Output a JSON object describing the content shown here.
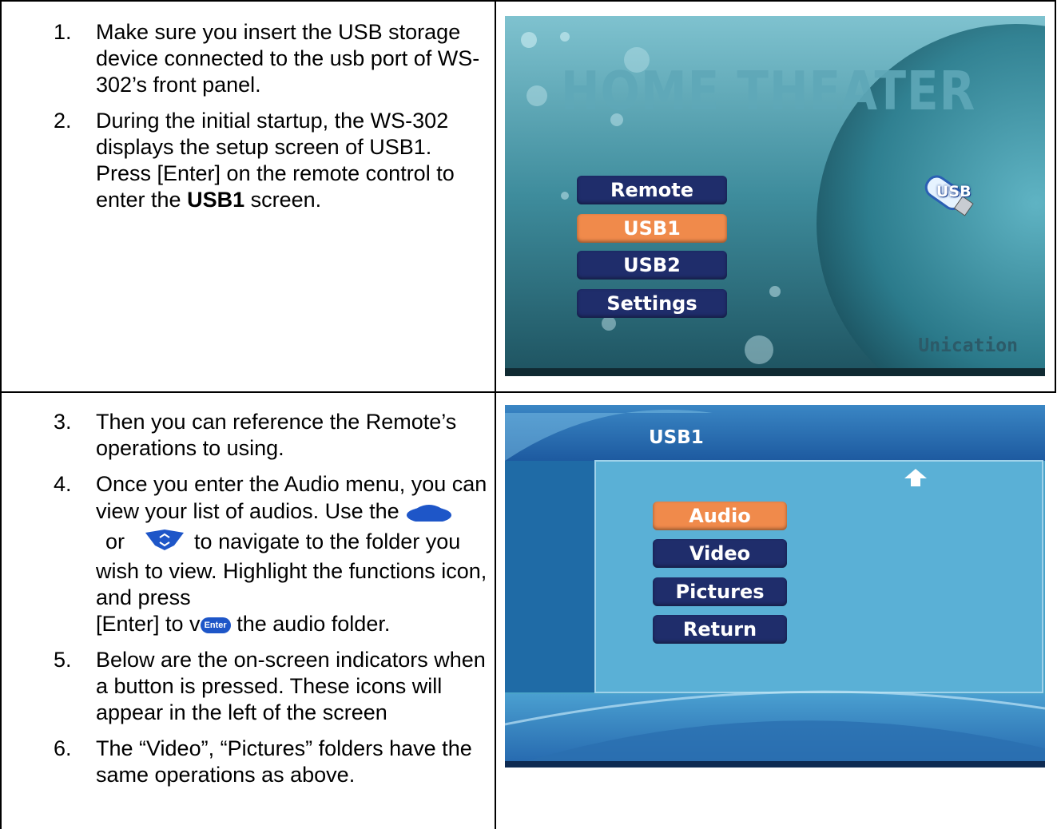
{
  "steps_top": [
    {
      "num": "1.",
      "text": "Make sure you insert the USB storage device connected to the usb port of WS-302’s front panel."
    },
    {
      "num": "2.",
      "text_a": "During the initial startup, the WS-302 displays the setup screen of USB1. Press [Enter] on the remote control to enter the ",
      "bold": "USB1",
      "text_b": " screen."
    }
  ],
  "steps_bottom": [
    {
      "num": "3.",
      "text": "Then you can reference the Remote’s operations to using."
    },
    {
      "num": "4.",
      "line1": "Once you enter the Audio menu, you can view your list of audios. Use the",
      "or": "or",
      "nav": "to navigate to the folder you wish to view. Highlight the functions icon, and press",
      "enter_a": "[Enter] to v",
      "enter_b": " the audio folder.",
      "enter_icon": "Enter"
    },
    {
      "num": "5.",
      "text": "Below are the on-screen indicators when a button is pressed. These icons will appear in the left of the screen"
    },
    {
      "num": "6.",
      "text": "The “Video”, “Pictures” folders have the same operations as above."
    }
  ],
  "screen1": {
    "title": "HOME THEATER",
    "menu": [
      "Remote",
      "USB1",
      "USB2",
      "Settings"
    ],
    "selected": 1,
    "usb_logo": "USB",
    "brand": "Unication"
  },
  "screen2": {
    "title": "USB1",
    "menu": [
      "Audio",
      "Video",
      "Pictures",
      "Return"
    ],
    "selected": 0
  },
  "colors": {
    "menu_dark": "#1f2d6b",
    "menu_selected": "#f08a4b",
    "teal_bg": "#3d8fa0",
    "blue_bg": "#4aa3c9"
  }
}
